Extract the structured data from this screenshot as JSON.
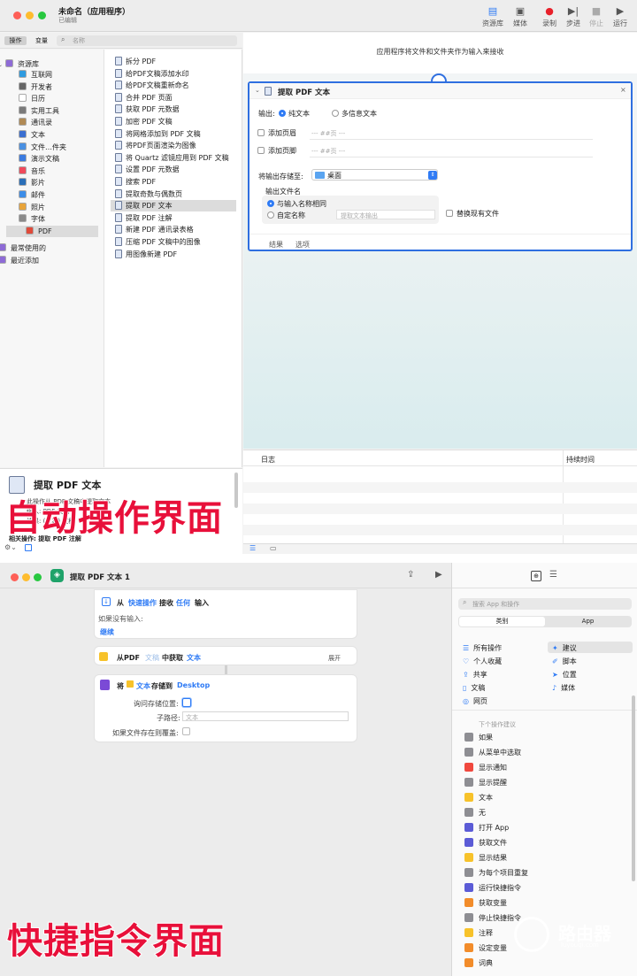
{
  "automator": {
    "window_title": "未命名（应用程序）",
    "window_subtitle": "已编辑",
    "toolbar": [
      "资源库",
      "媒体",
      "录制",
      "步进",
      "停止",
      "运行"
    ],
    "tabs": {
      "actions": "操作",
      "variables": "变量"
    },
    "search_placeholder": "名称",
    "library": [
      {
        "label": "资源库",
        "color": "#8e6bd6"
      },
      {
        "label": "互联网",
        "color": "#2f9be0"
      },
      {
        "label": "开发者",
        "color": "#666666"
      },
      {
        "label": "日历",
        "color": "#ffffff"
      },
      {
        "label": "实用工具",
        "color": "#7a7a7a"
      },
      {
        "label": "通讯录",
        "color": "#b08a55"
      },
      {
        "label": "文本",
        "color": "#3a6fd1"
      },
      {
        "label": "文件…件夹",
        "color": "#4a90e2"
      },
      {
        "label": "演示文稿",
        "color": "#3b7be0"
      },
      {
        "label": "音乐",
        "color": "#f04a5b"
      },
      {
        "label": "影片",
        "color": "#2a6fb8"
      },
      {
        "label": "邮件",
        "color": "#3c8de8"
      },
      {
        "label": "照片",
        "color": "#e8a43a"
      },
      {
        "label": "字体",
        "color": "#8a8a8a"
      },
      {
        "label": "PDF",
        "color": "#e04a3a"
      },
      {
        "label": "最常使用的",
        "color": "#8e6bd6"
      },
      {
        "label": "最近添加",
        "color": "#8e6bd6"
      }
    ],
    "actions": [
      "拆分 PDF",
      "给PDF文稿添加水印",
      "给PDF文稿重新命名",
      "合并 PDF 页面",
      "获取 PDF 元数据",
      "加密 PDF 文稿",
      "将网格添加到 PDF 文稿",
      "将PDF页面渲染为图像",
      "将 Quartz 滤镜应用到 PDF 文稿",
      "设置 PDF 元数据",
      "搜索 PDF",
      "提取奇数与偶数页",
      "提取 PDF 文本",
      "提取 PDF 注解",
      "新建 PDF 通讯录表格",
      "压缩 PDF 文稿中的图像",
      "用图像新建 PDF"
    ],
    "workflow_hint": "应用程序将文件和文件夹作为输入来接收",
    "action_card": {
      "title": "提取 PDF 文本",
      "output_label": "输出:",
      "output_plain": "纯文本",
      "output_rich": "多信息文本",
      "header_label": "添加页眉",
      "header_placeholder": "--- ##页 ---",
      "footer_label": "添加页脚",
      "footer_placeholder": "--- ##页 ---",
      "save_label": "将输出存储至:",
      "save_value": "桌面",
      "filename_label": "输出文件名",
      "same_name": "与输入名称相同",
      "custom_name": "自定名称",
      "custom_placeholder": "提取文本输出",
      "replace_label": "替换现有文件",
      "results": "结果",
      "options": "选项"
    },
    "log_columns": {
      "log": "日志",
      "duration": "持续时间"
    },
    "info": {
      "title": "提取 PDF 文本",
      "lines": [
        "此操作从 PDF 文稿中提取文本",
        "输入: PDF 文稿",
        "结果: (文本) 文稿"
      ],
      "related": "相关操作: 提取 PDF 注解"
    },
    "overlay_label": "自动操作界面"
  },
  "shortcuts": {
    "title": "提取 PDF 文本 1",
    "card1": {
      "from": "从",
      "quick": "快速操作",
      "receive": "接收",
      "any": "任何",
      "input": "输入",
      "no_input": "如果没有输入:",
      "continue": "继续"
    },
    "card2": {
      "from": "从PDF",
      "doc": "文稿",
      "get": "中获取",
      "text": "文本",
      "expand": "展开"
    },
    "card3": {
      "save": "将",
      "text": "文本",
      "store": "存储到",
      "dest": "Desktop",
      "ask": "询问存储位置:",
      "subpath": "子路径:",
      "subpath_placeholder": "文本",
      "overwrite": "如果文件存在则覆盖:"
    },
    "search_placeholder": "搜索 App 和操作",
    "segments": {
      "categories": "类别",
      "apps": "App"
    },
    "categories_left": [
      "所有操作",
      "个人收藏",
      "共享",
      "文稿",
      "网页"
    ],
    "categories_right": [
      "建议",
      "脚本",
      "位置",
      "媒体"
    ],
    "next_title": "下个操作建议",
    "suggestions": [
      {
        "label": "如果",
        "color": "#8e8e93"
      },
      {
        "label": "从菜单中选取",
        "color": "#8e8e93"
      },
      {
        "label": "显示通知",
        "color": "#f0483e"
      },
      {
        "label": "显示提醒",
        "color": "#8e8e93"
      },
      {
        "label": "文本",
        "color": "#f7c22a"
      },
      {
        "label": "无",
        "color": "#8e8e93"
      },
      {
        "label": "打开 App",
        "color": "#5b5bd6"
      },
      {
        "label": "获取文件",
        "color": "#5b5bd6"
      },
      {
        "label": "显示结果",
        "color": "#f7c22a"
      },
      {
        "label": "为每个项目重复",
        "color": "#8e8e93"
      },
      {
        "label": "运行快捷指令",
        "color": "#5b5bd6"
      },
      {
        "label": "获取变量",
        "color": "#f28c2a"
      },
      {
        "label": "停止快捷指令",
        "color": "#8e8e93"
      },
      {
        "label": "注释",
        "color": "#f7c22a"
      },
      {
        "label": "设定变量",
        "color": "#f28c2a"
      },
      {
        "label": "词典",
        "color": "#f28c2a"
      }
    ],
    "overlay_label": "快捷指令界面"
  },
  "watermark": {
    "brand": "路由器",
    "url": "luyouqi.com"
  }
}
